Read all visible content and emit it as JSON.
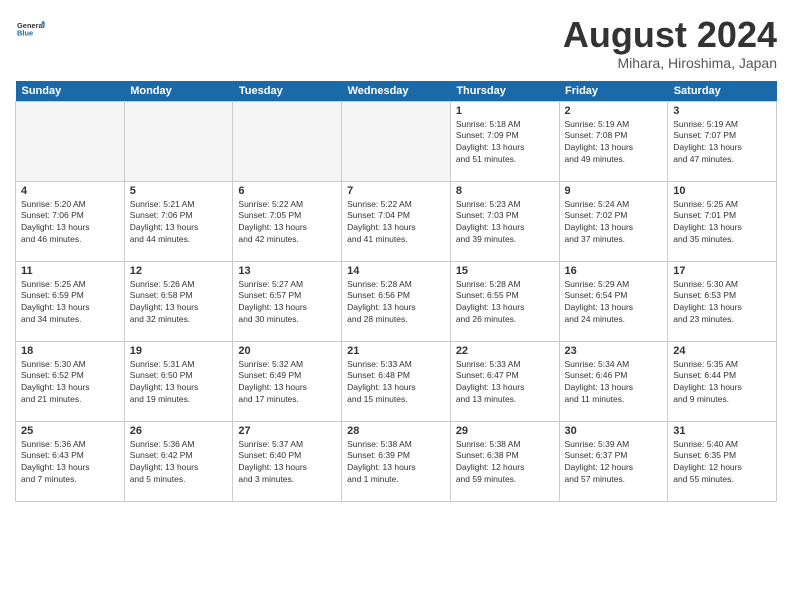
{
  "header": {
    "logo_line1": "General",
    "logo_line2": "Blue",
    "month_title": "August 2024",
    "location": "Mihara, Hiroshima, Japan"
  },
  "weekdays": [
    "Sunday",
    "Monday",
    "Tuesday",
    "Wednesday",
    "Thursday",
    "Friday",
    "Saturday"
  ],
  "weeks": [
    [
      {
        "day": "",
        "info": ""
      },
      {
        "day": "",
        "info": ""
      },
      {
        "day": "",
        "info": ""
      },
      {
        "day": "",
        "info": ""
      },
      {
        "day": "1",
        "info": "Sunrise: 5:18 AM\nSunset: 7:09 PM\nDaylight: 13 hours\nand 51 minutes."
      },
      {
        "day": "2",
        "info": "Sunrise: 5:19 AM\nSunset: 7:08 PM\nDaylight: 13 hours\nand 49 minutes."
      },
      {
        "day": "3",
        "info": "Sunrise: 5:19 AM\nSunset: 7:07 PM\nDaylight: 13 hours\nand 47 minutes."
      }
    ],
    [
      {
        "day": "4",
        "info": "Sunrise: 5:20 AM\nSunset: 7:06 PM\nDaylight: 13 hours\nand 46 minutes."
      },
      {
        "day": "5",
        "info": "Sunrise: 5:21 AM\nSunset: 7:06 PM\nDaylight: 13 hours\nand 44 minutes."
      },
      {
        "day": "6",
        "info": "Sunrise: 5:22 AM\nSunset: 7:05 PM\nDaylight: 13 hours\nand 42 minutes."
      },
      {
        "day": "7",
        "info": "Sunrise: 5:22 AM\nSunset: 7:04 PM\nDaylight: 13 hours\nand 41 minutes."
      },
      {
        "day": "8",
        "info": "Sunrise: 5:23 AM\nSunset: 7:03 PM\nDaylight: 13 hours\nand 39 minutes."
      },
      {
        "day": "9",
        "info": "Sunrise: 5:24 AM\nSunset: 7:02 PM\nDaylight: 13 hours\nand 37 minutes."
      },
      {
        "day": "10",
        "info": "Sunrise: 5:25 AM\nSunset: 7:01 PM\nDaylight: 13 hours\nand 35 minutes."
      }
    ],
    [
      {
        "day": "11",
        "info": "Sunrise: 5:25 AM\nSunset: 6:59 PM\nDaylight: 13 hours\nand 34 minutes."
      },
      {
        "day": "12",
        "info": "Sunrise: 5:26 AM\nSunset: 6:58 PM\nDaylight: 13 hours\nand 32 minutes."
      },
      {
        "day": "13",
        "info": "Sunrise: 5:27 AM\nSunset: 6:57 PM\nDaylight: 13 hours\nand 30 minutes."
      },
      {
        "day": "14",
        "info": "Sunrise: 5:28 AM\nSunset: 6:56 PM\nDaylight: 13 hours\nand 28 minutes."
      },
      {
        "day": "15",
        "info": "Sunrise: 5:28 AM\nSunset: 6:55 PM\nDaylight: 13 hours\nand 26 minutes."
      },
      {
        "day": "16",
        "info": "Sunrise: 5:29 AM\nSunset: 6:54 PM\nDaylight: 13 hours\nand 24 minutes."
      },
      {
        "day": "17",
        "info": "Sunrise: 5:30 AM\nSunset: 6:53 PM\nDaylight: 13 hours\nand 23 minutes."
      }
    ],
    [
      {
        "day": "18",
        "info": "Sunrise: 5:30 AM\nSunset: 6:52 PM\nDaylight: 13 hours\nand 21 minutes."
      },
      {
        "day": "19",
        "info": "Sunrise: 5:31 AM\nSunset: 6:50 PM\nDaylight: 13 hours\nand 19 minutes."
      },
      {
        "day": "20",
        "info": "Sunrise: 5:32 AM\nSunset: 6:49 PM\nDaylight: 13 hours\nand 17 minutes."
      },
      {
        "day": "21",
        "info": "Sunrise: 5:33 AM\nSunset: 6:48 PM\nDaylight: 13 hours\nand 15 minutes."
      },
      {
        "day": "22",
        "info": "Sunrise: 5:33 AM\nSunset: 6:47 PM\nDaylight: 13 hours\nand 13 minutes."
      },
      {
        "day": "23",
        "info": "Sunrise: 5:34 AM\nSunset: 6:46 PM\nDaylight: 13 hours\nand 11 minutes."
      },
      {
        "day": "24",
        "info": "Sunrise: 5:35 AM\nSunset: 6:44 PM\nDaylight: 13 hours\nand 9 minutes."
      }
    ],
    [
      {
        "day": "25",
        "info": "Sunrise: 5:36 AM\nSunset: 6:43 PM\nDaylight: 13 hours\nand 7 minutes."
      },
      {
        "day": "26",
        "info": "Sunrise: 5:36 AM\nSunset: 6:42 PM\nDaylight: 13 hours\nand 5 minutes."
      },
      {
        "day": "27",
        "info": "Sunrise: 5:37 AM\nSunset: 6:40 PM\nDaylight: 13 hours\nand 3 minutes."
      },
      {
        "day": "28",
        "info": "Sunrise: 5:38 AM\nSunset: 6:39 PM\nDaylight: 13 hours\nand 1 minute."
      },
      {
        "day": "29",
        "info": "Sunrise: 5:38 AM\nSunset: 6:38 PM\nDaylight: 12 hours\nand 59 minutes."
      },
      {
        "day": "30",
        "info": "Sunrise: 5:39 AM\nSunset: 6:37 PM\nDaylight: 12 hours\nand 57 minutes."
      },
      {
        "day": "31",
        "info": "Sunrise: 5:40 AM\nSunset: 6:35 PM\nDaylight: 12 hours\nand 55 minutes."
      }
    ]
  ]
}
